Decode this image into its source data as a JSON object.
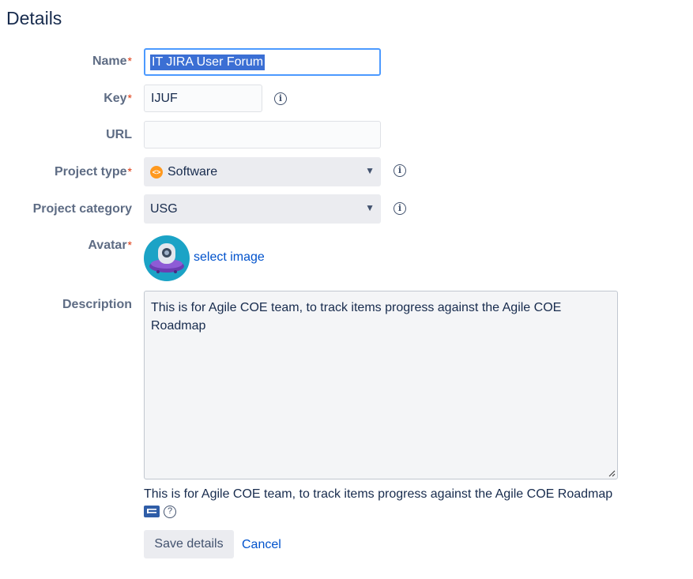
{
  "page": {
    "title": "Details"
  },
  "form": {
    "name": {
      "label": "Name",
      "required": "*",
      "value": "IT JIRA User Forum"
    },
    "key": {
      "label": "Key",
      "required": "*",
      "value": "IJUF"
    },
    "url": {
      "label": "URL",
      "value": ""
    },
    "project_type": {
      "label": "Project type",
      "required": "*",
      "value": "Software",
      "icon": "software-icon"
    },
    "project_category": {
      "label": "Project category",
      "value": "USG"
    },
    "avatar": {
      "label": "Avatar",
      "required": "*",
      "link": "select image"
    },
    "description": {
      "label": "Description",
      "value": "This is for Agile COE team, to track items progress against the Agile COE Roadmap",
      "preview": "This is for Agile COE team, to track items progress against the Agile COE Roadmap"
    }
  },
  "actions": {
    "save_label": "Save details",
    "cancel_label": "Cancel"
  },
  "colors": {
    "accent": "#0052cc",
    "focus": "#4c9aff",
    "required": "#de350b",
    "software": "#ff991f",
    "avatar_bg": "#1ba3c6"
  }
}
